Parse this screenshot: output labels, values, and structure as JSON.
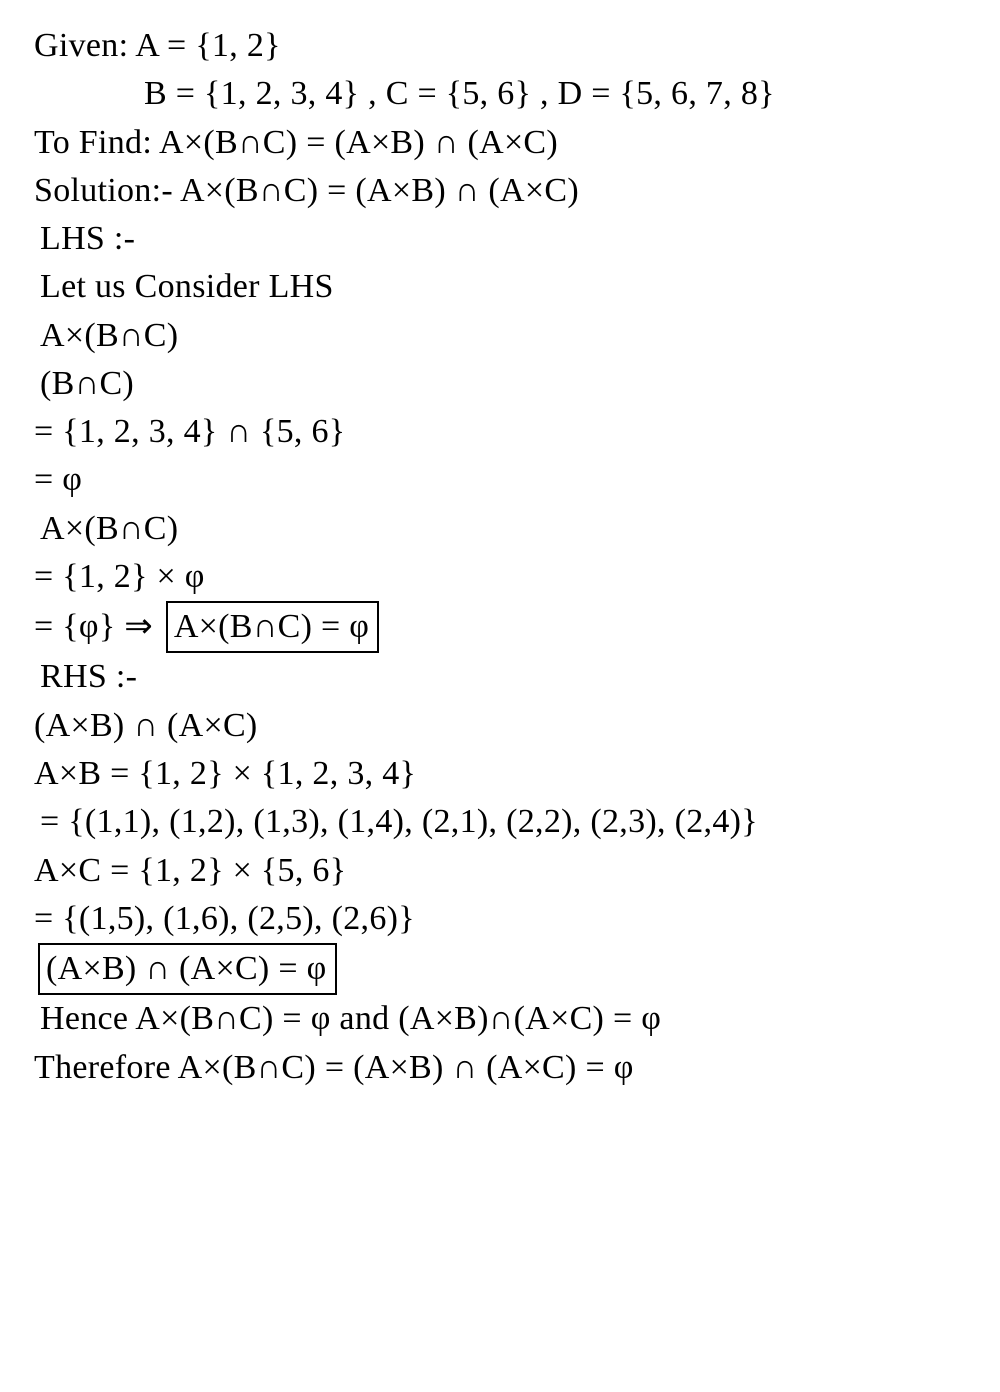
{
  "lines": {
    "l1": "Given: A = {1, 2}",
    "l2": "B = {1, 2, 3, 4} ,  C = {5, 6} , D = {5, 6, 7, 8}",
    "l3": "To Find:  A×(B∩C) = (A×B) ∩ (A×C)",
    "l4": "Solution:-  A×(B∩C) = (A×B) ∩ (A×C)",
    "l5": "LHS :-",
    "l6": "Let us Consider LHS",
    "l7": "A×(B∩C)",
    "l8": "(B∩C)",
    "l9": "= {1, 2, 3, 4} ∩ {5, 6}",
    "l10": "= φ",
    "l11": "A×(B∩C)",
    "l12": "= {1, 2} × φ",
    "l13a": "= {φ}  ⇒ ",
    "l13b": "A×(B∩C) = φ",
    "l14": "RHS :-",
    "l15": "(A×B) ∩ (A×C)",
    "l16": "A×B = {1, 2} × {1, 2, 3, 4}",
    "l17": "= {(1,1), (1,2), (1,3), (1,4), (2,1), (2,2), (2,3), (2,4)}",
    "l18": "A×C = {1, 2} × {5, 6}",
    "l19": "= {(1,5), (1,6), (2,5), (2,6)}",
    "l20": "(A×B) ∩ (A×C) = φ",
    "l21": "Hence  A×(B∩C) = φ  and  (A×B)∩(A×C) = φ",
    "l22": "Therefore  A×(B∩C) = (A×B) ∩ (A×C)  = φ"
  }
}
